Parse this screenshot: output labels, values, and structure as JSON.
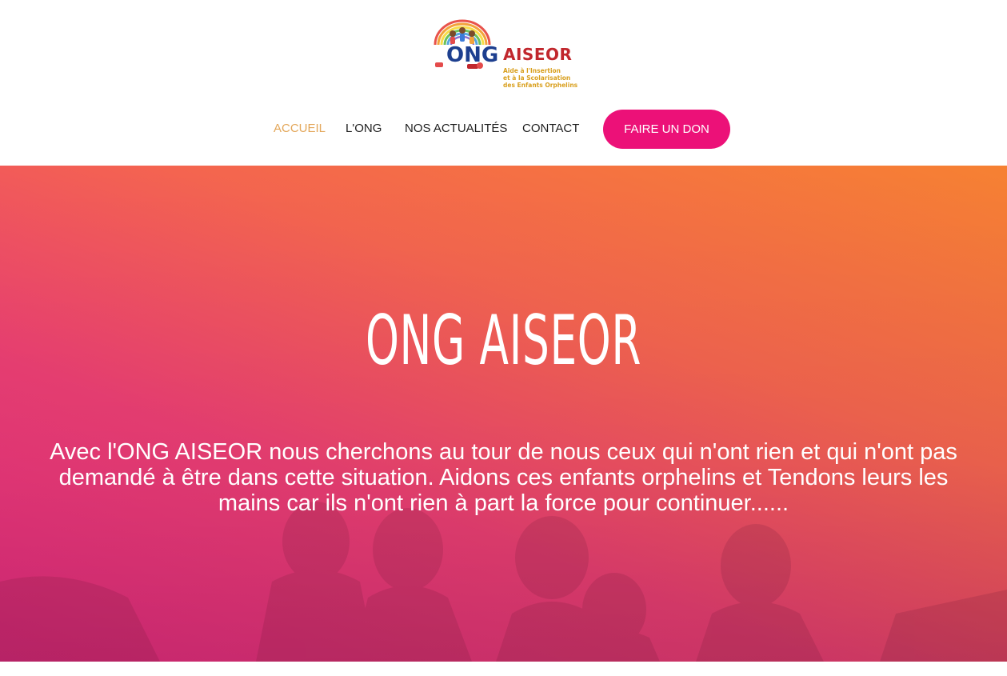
{
  "logo": {
    "prefix": "ONG",
    "name": "AISEOR",
    "tagline_line1": "Aide à l'Insertion",
    "tagline_line2": "et à la Scolarisation",
    "tagline_line3": "des Enfants Orphelins"
  },
  "nav": {
    "items": [
      {
        "label": "ACCUEIL",
        "active": true
      },
      {
        "label": "L'ONG",
        "active": false
      },
      {
        "label": "NOS ACTUALITÉS",
        "active": false
      },
      {
        "label": "CONTACT",
        "active": false
      }
    ],
    "donate_label": "FAIRE UN DON"
  },
  "hero": {
    "title": "ONG AISEOR",
    "text": "Avec l'ONG AISEOR nous cherchons au tour de nous ceux qui n'ont rien et qui n'ont pas demandé à être dans cette situation. Aidons ces enfants orphelins et Tendons leurs les mains car ils n'ont rien à part la force pour continuer......"
  },
  "colors": {
    "accent_pink": "#ec1178",
    "active_nav": "#e3a75a",
    "gradient_start": "#f68132",
    "gradient_end": "#e82b83",
    "logo_blue": "#1d3f8f",
    "logo_red": "#c1272d",
    "logo_gold": "#d9a01f"
  }
}
